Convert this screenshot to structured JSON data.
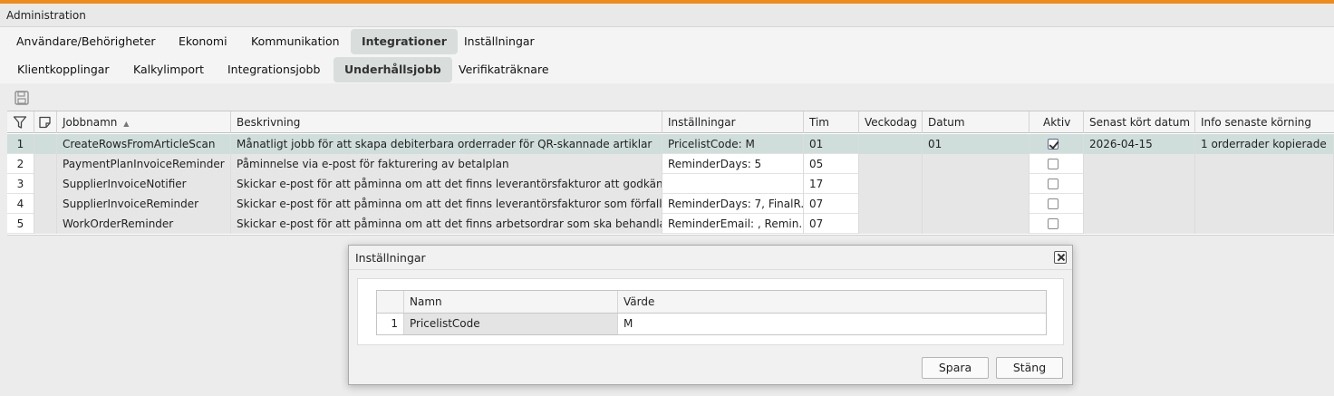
{
  "window": {
    "title": "Administration"
  },
  "tabs_main": [
    {
      "label": "Användare/Behörigheter",
      "active": false
    },
    {
      "label": "Ekonomi",
      "active": false
    },
    {
      "label": "Kommunikation",
      "active": false
    },
    {
      "label": "Integrationer",
      "active": true
    },
    {
      "label": "Inställningar",
      "active": false
    }
  ],
  "tabs_sub": [
    {
      "label": "Klientkopplingar",
      "active": false
    },
    {
      "label": "Kalkylimport",
      "active": false
    },
    {
      "label": "Integrationsjobb",
      "active": false
    },
    {
      "label": "Underhållsjobb",
      "active": true
    },
    {
      "label": "Verifikaträknare",
      "active": false
    }
  ],
  "grid": {
    "columns": {
      "jobbnamn": "Jobbnamn",
      "beskrivning": "Beskrivning",
      "installningar": "Inställningar",
      "tim": "Tim",
      "veckodag": "Veckodag",
      "datum": "Datum",
      "aktiv": "Aktiv",
      "senast": "Senast kört datum",
      "info": "Info senaste körning"
    },
    "rows": [
      {
        "nr": "1",
        "jobbnamn": "CreateRowsFromArticleScan",
        "beskrivning": "Månatligt jobb för att skapa debiterbara orderrader för QR-skannade artiklar",
        "installningar": "PricelistCode: M",
        "tim": "01",
        "veckodag": "",
        "datum": "01",
        "aktiv": true,
        "senast": "2026-04-15",
        "info": "1 orderrader kopierade",
        "selected": true
      },
      {
        "nr": "2",
        "jobbnamn": "PaymentPlanInvoiceReminder",
        "beskrivning": "Påminnelse via e-post för fakturering av betalplan",
        "installningar": "ReminderDays: 5",
        "tim": "05",
        "veckodag": "",
        "datum": "",
        "aktiv": false,
        "senast": "",
        "info": "",
        "selected": false
      },
      {
        "nr": "3",
        "jobbnamn": "SupplierInvoiceNotifier",
        "beskrivning": "Skickar e-post för att påminna om att det finns leverantörsfakturor att godkänna",
        "installningar": "",
        "tim": "17",
        "veckodag": "",
        "datum": "",
        "aktiv": false,
        "senast": "",
        "info": "",
        "selected": false
      },
      {
        "nr": "4",
        "jobbnamn": "SupplierInvoiceReminder",
        "beskrivning": "Skickar e-post för att påminna om att det finns leverantörsfakturor som förfaller i...",
        "installningar": "ReminderDays: 7, FinalR...",
        "tim": "07",
        "veckodag": "",
        "datum": "",
        "aktiv": false,
        "senast": "",
        "info": "",
        "selected": false
      },
      {
        "nr": "5",
        "jobbnamn": "WorkOrderReminder",
        "beskrivning": "Skickar e-post för att påminna om att det finns arbetsordrar som ska behandlas",
        "installningar": "ReminderEmail: , Remin...",
        "tim": "07",
        "veckodag": "",
        "datum": "",
        "aktiv": false,
        "senast": "",
        "info": "",
        "selected": false
      }
    ]
  },
  "dialog": {
    "title": "Inställningar",
    "columns": {
      "namn": "Namn",
      "varde": "Värde"
    },
    "rows": [
      {
        "nr": "1",
        "namn": "PricelistCode",
        "varde": "M"
      }
    ],
    "save_label": "Spara",
    "close_label": "Stäng"
  },
  "icons": {
    "save": "save-icon",
    "filter": "filter-icon",
    "edit": "edit-icon",
    "sort": "sort-asc-icon",
    "close": "close-icon"
  },
  "colors": {
    "accent": "#f08a1c",
    "selected_row": "#cfdedb",
    "active_tab": "#d9dedd"
  }
}
